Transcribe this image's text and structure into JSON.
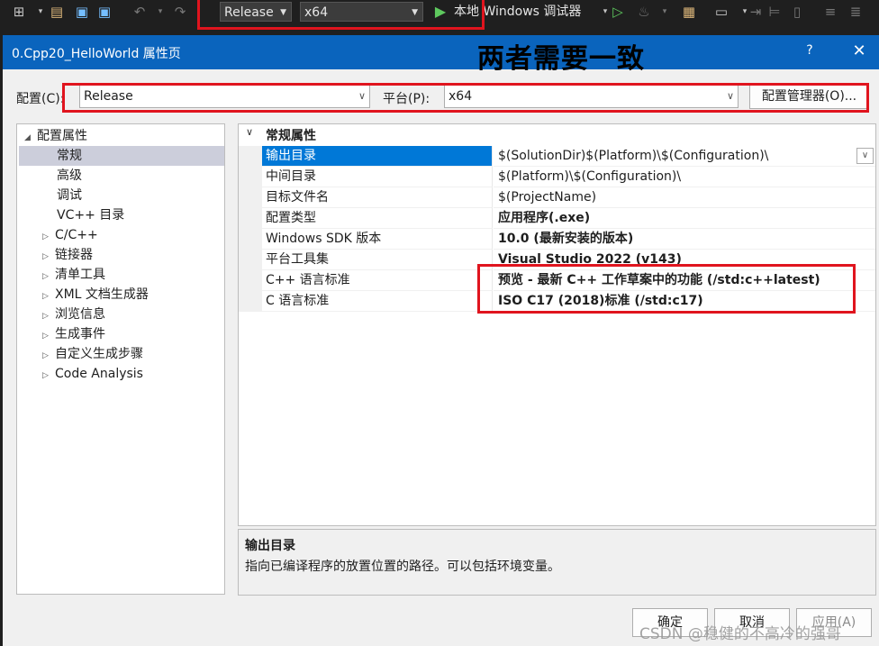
{
  "toolbar": {
    "configuration": "Release",
    "platform": "x64",
    "run_target": "本地 Windows 调试器"
  },
  "dialog": {
    "title": "0.Cpp20_HelloWorld 属性页",
    "annotation": "两者需要一致",
    "help": "?",
    "close": "✕"
  },
  "config_bar": {
    "config_label": "配置(C):",
    "config_value": "Release",
    "platform_label": "平台(P):",
    "platform_value": "x64",
    "manager_button": "配置管理器(O)..."
  },
  "tree": {
    "items": [
      {
        "label": "配置属性",
        "toggle": "◢"
      },
      {
        "label": "常规",
        "toggle": ""
      },
      {
        "label": "高级",
        "toggle": ""
      },
      {
        "label": "调试",
        "toggle": ""
      },
      {
        "label": "VC++ 目录",
        "toggle": ""
      },
      {
        "label": "C/C++",
        "toggle": "▷"
      },
      {
        "label": "链接器",
        "toggle": "▷"
      },
      {
        "label": "清单工具",
        "toggle": "▷"
      },
      {
        "label": "XML 文档生成器",
        "toggle": "▷"
      },
      {
        "label": "浏览信息",
        "toggle": "▷"
      },
      {
        "label": "生成事件",
        "toggle": "▷"
      },
      {
        "label": "自定义生成步骤",
        "toggle": "▷"
      },
      {
        "label": "Code Analysis",
        "toggle": "▷"
      }
    ]
  },
  "grid": {
    "category": "常规属性",
    "rows": [
      {
        "name": "输出目录",
        "value": "$(SolutionDir)$(Platform)\\$(Configuration)\\"
      },
      {
        "name": "中间目录",
        "value": "$(Platform)\\$(Configuration)\\"
      },
      {
        "name": "目标文件名",
        "value": "$(ProjectName)"
      },
      {
        "name": "配置类型",
        "value": "应用程序(.exe)"
      },
      {
        "name": "Windows SDK 版本",
        "value": "10.0 (最新安装的版本)"
      },
      {
        "name": "平台工具集",
        "value": "Visual Studio 2022 (v143)"
      },
      {
        "name": "C++ 语言标准",
        "value": "预览 - 最新 C++ 工作草案中的功能 (/std:c++latest)"
      },
      {
        "name": "C 语言标准",
        "value": "ISO C17 (2018)标准 (/std:c17)"
      }
    ]
  },
  "description": {
    "title": "输出目录",
    "text": "指向已编译程序的放置位置的路径。可以包括环境变量。"
  },
  "buttons": {
    "ok": "确定",
    "cancel": "取消",
    "apply": "应用(A)"
  },
  "watermark": "CSDN @稳健的不高冷的强哥",
  "colors": {
    "accent": "#0a64bd",
    "selection": "#0078d7",
    "highlight_box": "#e0141e"
  }
}
